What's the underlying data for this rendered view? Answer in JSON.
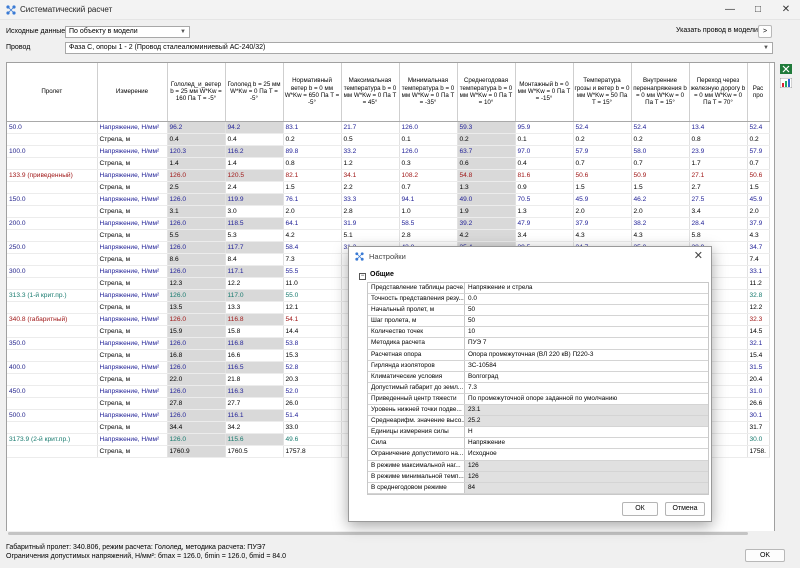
{
  "window": {
    "title": "Систематический расчет"
  },
  "top": {
    "source_label": "Исходные данные",
    "source_value": "По объекту в модели",
    "wire_label": "Провод",
    "wire_value": "Фаза С, опоры 1 - 2 (Провод сталеалюминиевый АС-240/32)",
    "model_wire_label": "Указать провод в модели",
    "model_wire_btn": ">"
  },
  "table": {
    "headers": [
      "Пролет",
      "Измерение",
      "Гололед_и_ветер b = 25 мм W*Kw = 160 Па T = -5°",
      "Гололед b = 25 мм W*Kw = 0 Па T = -5°",
      "Нормативный ветер b = 0 мм W*Kw = 650 Па T = -5°",
      "Максимальная температура b = 0 мм W*Kw = 0 Па T = 45°",
      "Минимальная температура b = 0 мм W*Kw = 0 Па T = -35°",
      "Среднегодовая температура b = 0 мм W*Kw = 0 Па T = 10°",
      "Монтажный b = 0 мм W*Kw = 0 Па T = -15°",
      "Температура грозы и ветер b = 0 мм W*Kw = 50 Па T = 15°",
      "Внутренние перенапряжения b = 0 мм W*Kw = 0 Па T = 15°",
      "Переход через железную дорогу b = 0 мм W*Kw = 0 Па T = 70°",
      "Рас про"
    ],
    "rows": [
      {
        "span": "50.0",
        "m": "Напряжение, Н/мм²",
        "v": [
          "96.2",
          "94.2",
          "83.1",
          "21.7",
          "126.0",
          "59.3",
          "95.9",
          "52.4",
          "52.4",
          "13.4",
          "52.4"
        ]
      },
      {
        "span": "",
        "m": "Стрела, м",
        "v": [
          "0.4",
          "0.4",
          "0.2",
          "0.5",
          "0.1",
          "0.2",
          "0.1",
          "0.2",
          "0.2",
          "0.8",
          "0.2"
        ]
      },
      {
        "span": "100.0",
        "m": "Напряжение, Н/мм²",
        "v": [
          "120.3",
          "116.2",
          "89.8",
          "33.2",
          "126.0",
          "63.7",
          "97.0",
          "57.9",
          "58.0",
          "23.9",
          "57.9"
        ]
      },
      {
        "span": "",
        "m": "Стрела, м",
        "v": [
          "1.4",
          "1.4",
          "0.8",
          "1.2",
          "0.3",
          "0.6",
          "0.4",
          "0.7",
          "0.7",
          "1.7",
          "0.7"
        ]
      },
      {
        "span": "133.9 (приведенный)",
        "c": "red",
        "m": "Напряжение, Н/мм²",
        "v": [
          "126.0",
          "120.5",
          "82.1",
          "34.1",
          "108.2",
          "54.8",
          "81.6",
          "50.6",
          "50.9",
          "27.1",
          "50.6"
        ]
      },
      {
        "span": "",
        "m": "Стрела, м",
        "v": [
          "2.5",
          "2.4",
          "1.5",
          "2.2",
          "0.7",
          "1.3",
          "0.9",
          "1.5",
          "1.5",
          "2.7",
          "1.5"
        ]
      },
      {
        "span": "150.0",
        "m": "Напряжение, Н/мм²",
        "v": [
          "126.0",
          "119.9",
          "76.1",
          "33.3",
          "94.1",
          "49.0",
          "70.5",
          "45.9",
          "46.2",
          "27.5",
          "45.9"
        ]
      },
      {
        "span": "",
        "m": "Стрела, м",
        "v": [
          "3.1",
          "3.0",
          "2.0",
          "2.8",
          "1.0",
          "1.9",
          "1.3",
          "2.0",
          "2.0",
          "3.4",
          "2.0"
        ]
      },
      {
        "span": "200.0",
        "m": "Напряжение, Н/мм²",
        "v": [
          "126.0",
          "118.5",
          "64.1",
          "31.9",
          "58.5",
          "39.2",
          "47.9",
          "37.9",
          "38.2",
          "28.4",
          "37.9"
        ]
      },
      {
        "span": "",
        "m": "Стрела, м",
        "v": [
          "5.5",
          "5.3",
          "4.2",
          "5.1",
          "2.8",
          "4.2",
          "3.4",
          "4.3",
          "4.3",
          "5.8",
          "4.3"
        ]
      },
      {
        "span": "250.0",
        "m": "Напряжение, Н/мм²",
        "v": [
          "126.0",
          "117.7",
          "58.4",
          "31.2",
          "43.8",
          "35.4",
          "39.5",
          "34.7",
          "35.0",
          "28.9",
          "34.7"
        ]
      },
      {
        "span": "",
        "m": "Стрела, м",
        "v": [
          "8.6",
          "8.4",
          "7.3",
          "",
          "",
          "",
          "",
          "",
          "",
          "",
          "7.4"
        ]
      },
      {
        "span": "300.0",
        "m": "Напряжение, Н/мм²",
        "v": [
          "126.0",
          "117.1",
          "55.5",
          "",
          "",
          "",
          "",
          "",
          "",
          "",
          "33.1"
        ]
      },
      {
        "span": "",
        "m": "Стрела, м",
        "v": [
          "12.3",
          "12.2",
          "11.0",
          "",
          "",
          "",
          "",
          "",
          "",
          "",
          "11.2"
        ]
      },
      {
        "span": "313.3 (1-й крит.пр.)",
        "c": "teal",
        "m": "Напряжение, Н/мм²",
        "v": [
          "126.0",
          "117.0",
          "55.0",
          "",
          "",
          "",
          "",
          "",
          "",
          "",
          "32.8"
        ]
      },
      {
        "span": "",
        "m": "Стрела, м",
        "v": [
          "13.5",
          "13.3",
          "12.1",
          "",
          "",
          "",
          "",
          "",
          "",
          "",
          "12.2"
        ]
      },
      {
        "span": "340.8 (габаритный)",
        "c": "red",
        "m": "Напряжение, Н/мм²",
        "v": [
          "126.0",
          "116.8",
          "54.1",
          "",
          "",
          "",
          "",
          "",
          "",
          "",
          "32.3"
        ]
      },
      {
        "span": "",
        "m": "Стрела, м",
        "v": [
          "15.9",
          "15.8",
          "14.4",
          "",
          "",
          "",
          "",
          "",
          "",
          "",
          "14.5"
        ]
      },
      {
        "span": "350.0",
        "m": "Напряжение, Н/мм²",
        "v": [
          "126.0",
          "116.8",
          "53.8",
          "",
          "",
          "",
          "",
          "",
          "",
          "",
          "32.1"
        ]
      },
      {
        "span": "",
        "m": "Стрела, м",
        "v": [
          "16.8",
          "16.6",
          "15.3",
          "",
          "",
          "",
          "",
          "",
          "",
          "",
          "15.4"
        ]
      },
      {
        "span": "400.0",
        "m": "Напряжение, Н/мм²",
        "v": [
          "126.0",
          "116.5",
          "52.8",
          "",
          "",
          "",
          "",
          "",
          "",
          "",
          "31.5"
        ]
      },
      {
        "span": "",
        "m": "Стрела, м",
        "v": [
          "22.0",
          "21.8",
          "20.3",
          "",
          "",
          "",
          "",
          "",
          "",
          "",
          "20.4"
        ]
      },
      {
        "span": "450.0",
        "m": "Напряжение, Н/мм²",
        "v": [
          "126.0",
          "116.3",
          "52.0",
          "",
          "",
          "",
          "",
          "",
          "",
          "",
          "31.0"
        ]
      },
      {
        "span": "",
        "m": "Стрела, м",
        "v": [
          "27.8",
          "27.7",
          "26.0",
          "",
          "",
          "",
          "",
          "",
          "",
          "",
          "26.6"
        ]
      },
      {
        "span": "500.0",
        "m": "Напряжение, Н/мм²",
        "v": [
          "126.0",
          "116.1",
          "51.4",
          "",
          "",
          "",
          "",
          "",
          "",
          "",
          "30.1"
        ]
      },
      {
        "span": "",
        "m": "Стрела, м",
        "v": [
          "34.4",
          "34.2",
          "33.0",
          "",
          "",
          "",
          "",
          "",
          "",
          "",
          "31.7"
        ]
      },
      {
        "span": "3173.9 (2-й крит.пр.)",
        "c": "teal",
        "m": "Напряжение, Н/мм²",
        "v": [
          "126.0",
          "115.6",
          "49.6",
          "",
          "",
          "",
          "",
          "",
          "",
          "",
          "30.0"
        ]
      },
      {
        "span": "",
        "m": "Стрела, м",
        "v": [
          "1760.9",
          "1760.5",
          "1757.8",
          "",
          "",
          "",
          "",
          "",
          "",
          "",
          "1758."
        ]
      }
    ]
  },
  "status": {
    "line1": "Габаритный пролет: 340.806, режим расчета: Гололед, методика расчета: ПУЭ7",
    "line2": "Ограничения допустимых напряжений, Н/мм²: бmax = 126.0, бmin = 126.0, бmid = 84.0",
    "ok": "OK"
  },
  "dialog": {
    "title": "Настройки",
    "section": "Общие",
    "ok": "ОК",
    "cancel": "Отмена",
    "props": [
      {
        "k": "Представление таблицы расче...",
        "v": "Напряжение и стрела"
      },
      {
        "k": "Точность представления резу...",
        "v": "0.0"
      },
      {
        "k": "Начальный пролет, м",
        "v": "50"
      },
      {
        "k": "Шаг пролета, м",
        "v": "50"
      },
      {
        "k": "Количество точек",
        "v": "10"
      },
      {
        "k": "Методика расчета",
        "v": "ПУЭ 7"
      },
      {
        "k": "Расчетная опора",
        "v": "Опора промежуточная (ВЛ 220 кВ) П220-3"
      },
      {
        "k": "Гирлянда изоляторов",
        "v": "ЗС-10584"
      },
      {
        "k": "Климатические условия",
        "v": "Волгоград"
      },
      {
        "k": "Допустимый габарит до земл...",
        "v": "7.3"
      },
      {
        "k": "Приведенный центр тяжести",
        "v": "По промежуточной опоре заданной по умолчанию"
      },
      {
        "k": "Уровень нижней точки подве...",
        "v": "23.1",
        "ro": true
      },
      {
        "k": "Среднеарифм. значение высо...",
        "v": "25.2",
        "ro": true
      },
      {
        "k": "Единицы измерения силы",
        "v": "Н"
      },
      {
        "k": "Сила",
        "v": "Напряжение"
      },
      {
        "k": "Ограничение допустимого на...",
        "v": "Исходное"
      },
      {
        "k": "В режиме максимальной наг...",
        "v": "126",
        "ro": true
      },
      {
        "k": "В режиме минимальной темп...",
        "v": "126",
        "ro": true
      },
      {
        "k": "В среднегодовом режиме",
        "v": "84",
        "ro": true
      }
    ]
  }
}
